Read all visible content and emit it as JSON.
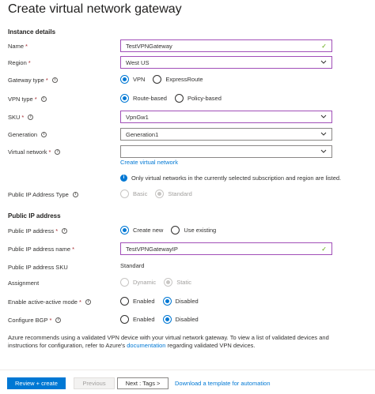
{
  "page": {
    "title": "Create virtual network gateway",
    "more": "···"
  },
  "sections": {
    "instance": "Instance details",
    "public_ip": "Public IP address"
  },
  "fields": {
    "name": {
      "label": "Name",
      "value": "TestVPNGateway"
    },
    "region": {
      "label": "Region",
      "value": "West US"
    },
    "gateway_type": {
      "label": "Gateway type",
      "options": [
        "VPN",
        "ExpressRoute"
      ],
      "selected": "VPN"
    },
    "vpn_type": {
      "label": "VPN type",
      "options": [
        "Route-based",
        "Policy-based"
      ],
      "selected": "Route-based"
    },
    "sku": {
      "label": "SKU",
      "value": "VpnGw1"
    },
    "generation": {
      "label": "Generation",
      "value": "Generation1"
    },
    "virtual_network": {
      "label": "Virtual network",
      "value": "",
      "create_link": "Create virtual network"
    },
    "vnet_note": "Only virtual networks in the currently selected subscription and region are listed.",
    "public_ip_type": {
      "label": "Public IP Address Type",
      "options": [
        "Basic",
        "Standard"
      ],
      "selected": "Standard"
    },
    "public_ip": {
      "label": "Public IP address",
      "options": [
        "Create new",
        "Use existing"
      ],
      "selected": "Create new"
    },
    "public_ip_name": {
      "label": "Public IP address name",
      "value": "TestVPNGatewayIP"
    },
    "public_ip_sku": {
      "label": "Public IP address SKU",
      "value": "Standard"
    },
    "assignment": {
      "label": "Assignment",
      "options": [
        "Dynamic",
        "Static"
      ],
      "selected": "Static"
    },
    "active_active": {
      "label": "Enable active-active mode",
      "options": [
        "Enabled",
        "Disabled"
      ],
      "selected": "Disabled"
    },
    "bgp": {
      "label": "Configure BGP",
      "options": [
        "Enabled",
        "Disabled"
      ],
      "selected": "Disabled"
    }
  },
  "footer": {
    "text_1": "Azure recommends using a validated VPN device with your virtual network gateway. To view a list of validated devices and instructions for configuration, refer to Azure's ",
    "doc_link": "documentation",
    "text_2": " regarding validated VPN devices."
  },
  "buttons": {
    "review_create": "Review + create",
    "previous": "Previous",
    "next": "Next : Tags >",
    "download": "Download a template for automation"
  },
  "colors": {
    "accent": "#0078d4",
    "focus_border": "#a14fb8",
    "required": "#a4262c",
    "valid_check": "#57a300"
  }
}
